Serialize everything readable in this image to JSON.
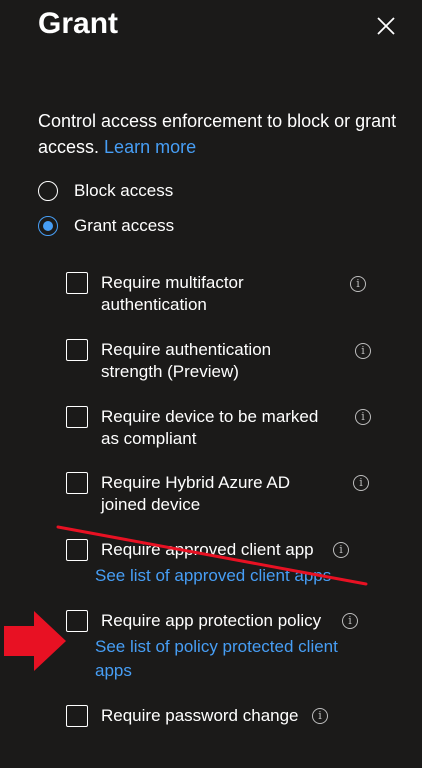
{
  "colors": {
    "panel_bg": "#1b1a19",
    "text": "#ffffff",
    "link": "#479ef5",
    "accent": "#479ef5",
    "annotation_red": "#e81123"
  },
  "header": {
    "title": "Grant",
    "close_icon": "close-icon"
  },
  "description": {
    "text": "Control access enforcement to block or grant access.",
    "link": "Learn more"
  },
  "access_mode": {
    "selected": "grant",
    "options": [
      {
        "id": "block",
        "label": "Block access",
        "checked": false
      },
      {
        "id": "grant",
        "label": "Grant access",
        "checked": true
      }
    ]
  },
  "controls": [
    {
      "label_lines": [
        "Require multifactor",
        "authentication"
      ],
      "checked": false
    },
    {
      "label_lines": [
        "Require authentication",
        "strength (Preview)"
      ],
      "checked": false
    },
    {
      "label_lines": [
        "Require device to be marked",
        "as compliant"
      ],
      "checked": false
    },
    {
      "label_lines": [
        "Require Hybrid Azure AD",
        "joined device"
      ],
      "checked": false
    },
    {
      "label_lines": [
        "Require approved client app"
      ],
      "link_lines": [
        "See list of approved client apps"
      ],
      "checked": false,
      "struck_through": true
    },
    {
      "label_lines": [
        "Require app protection policy"
      ],
      "link_lines": [
        "See list of policy protected client",
        "apps"
      ],
      "checked": false,
      "highlighted_by_arrow": true
    },
    {
      "label_lines": [
        "Require password change"
      ],
      "checked": false
    }
  ],
  "annotations": {
    "strike_line": "red-strike-line",
    "arrow": "red-arrow-icon"
  }
}
